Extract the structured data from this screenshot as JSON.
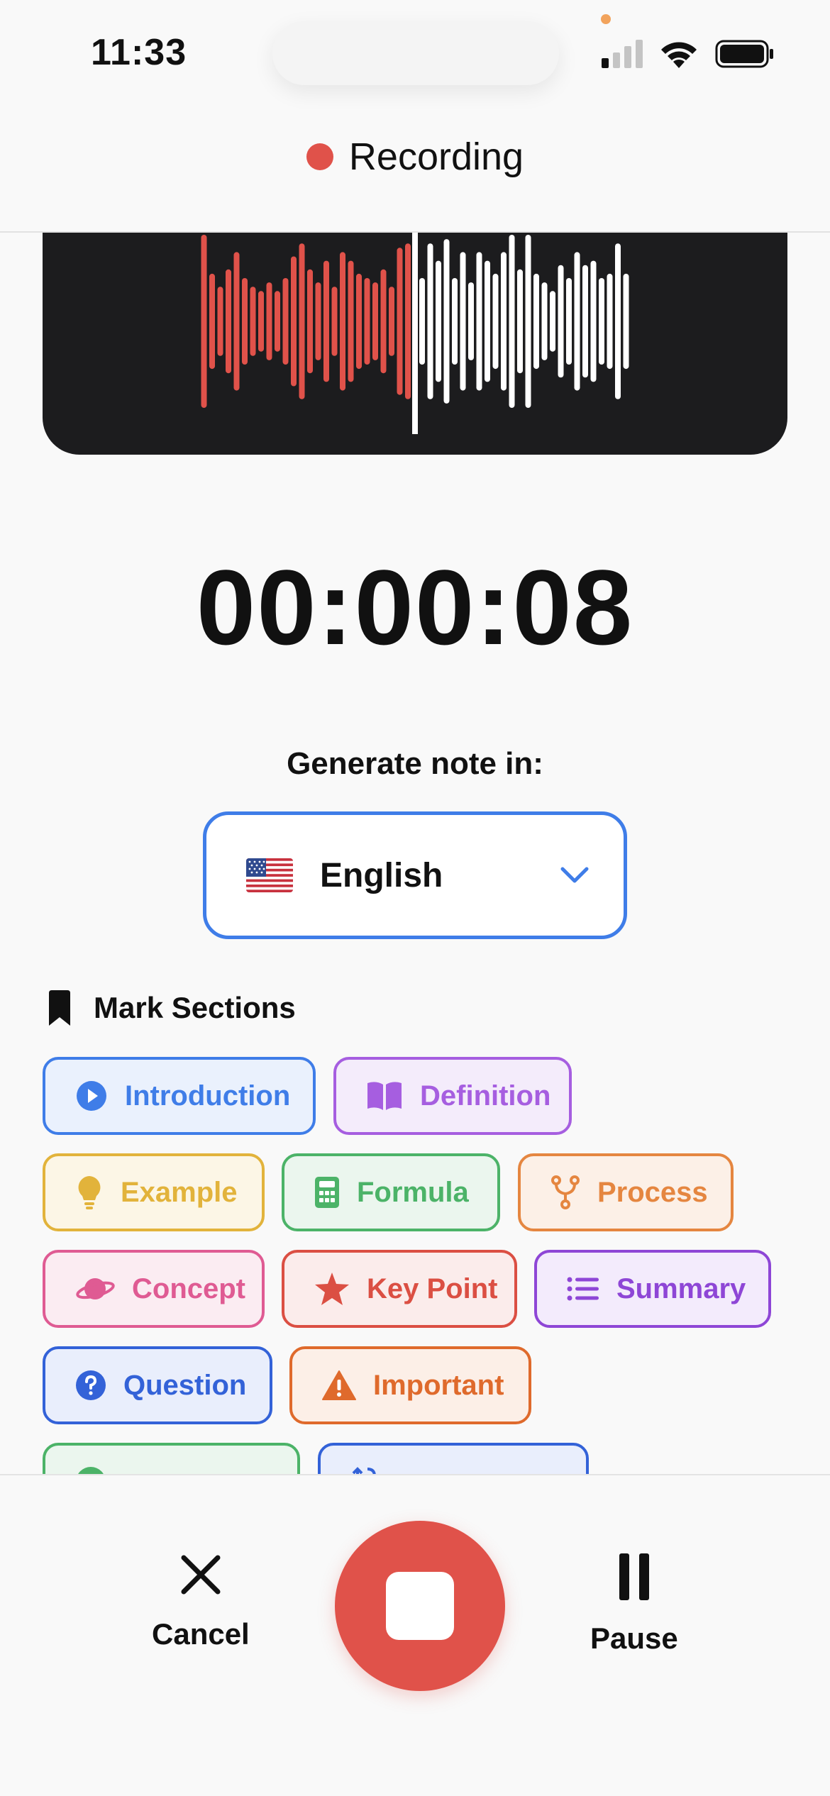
{
  "status_bar": {
    "time": "11:33"
  },
  "recording": {
    "label": "Recording",
    "color": "#e0524a"
  },
  "waveform": {
    "played_color": "#e0524a",
    "unplayed_color": "#ffffff",
    "playhead_fraction": 0.5,
    "played_levels": [
      1.0,
      0.55,
      0.4,
      0.6,
      0.8,
      0.5,
      0.4,
      0.35,
      0.45,
      0.35,
      0.5,
      0.75,
      0.9,
      0.6,
      0.45,
      0.7,
      0.4,
      0.8,
      0.7,
      0.55,
      0.5,
      0.45,
      0.6,
      0.4,
      0.85,
      0.9
    ],
    "unplayed_levels": [
      0.5,
      0.9,
      0.7,
      0.95,
      0.5,
      0.8,
      0.45,
      0.8,
      0.7,
      0.55,
      0.8,
      1.0,
      0.6,
      1.0,
      0.55,
      0.45,
      0.35,
      0.65,
      0.5,
      0.8,
      0.65,
      0.7,
      0.5,
      0.55,
      0.9,
      0.55
    ]
  },
  "timer": {
    "value": "00:00:08"
  },
  "generate": {
    "label": "Generate note in:",
    "language": "English",
    "flag_icon": "us-flag-icon",
    "accent": "#3f7de8"
  },
  "marks": {
    "title": "Mark Sections",
    "chips": [
      {
        "label": "Introduction",
        "icon": "play-circle-icon",
        "color": "#3f7de8",
        "bg": "#eaf1fd"
      },
      {
        "label": "Definition",
        "icon": "book-icon",
        "color": "#a65ee0",
        "bg": "#f4ecfb"
      },
      {
        "label": "Example",
        "icon": "lightbulb-icon",
        "color": "#e2b33b",
        "bg": "#fcf6e6"
      },
      {
        "label": "Formula",
        "icon": "calculator-icon",
        "color": "#4cb368",
        "bg": "#ebf6ee"
      },
      {
        "label": "Process",
        "icon": "fork-icon",
        "color": "#e58640",
        "bg": "#fcf0e7"
      },
      {
        "label": "Concept",
        "icon": "planet-icon",
        "color": "#df5b93",
        "bg": "#fbecf2"
      },
      {
        "label": "Key Point",
        "icon": "star-icon",
        "color": "#db4f43",
        "bg": "#fbeceb"
      },
      {
        "label": "Summary",
        "icon": "list-icon",
        "color": "#8e46d6",
        "bg": "#f3ebfc"
      },
      {
        "label": "Question",
        "icon": "question-circle-icon",
        "color": "#3362d8",
        "bg": "#e9eefc"
      },
      {
        "label": "Important",
        "icon": "warning-icon",
        "color": "#df6a2c",
        "bg": "#fcefe7"
      },
      {
        "label": "",
        "icon": "check-circle-icon",
        "color": "#4cb368",
        "bg": "#ebf6ee"
      },
      {
        "label": "",
        "icon": "transfer-icon",
        "color": "#3362d8",
        "bg": "#e9eefc"
      }
    ]
  },
  "controls": {
    "cancel_label": "Cancel",
    "pause_label": "Pause",
    "stop_color": "#e0524a"
  }
}
